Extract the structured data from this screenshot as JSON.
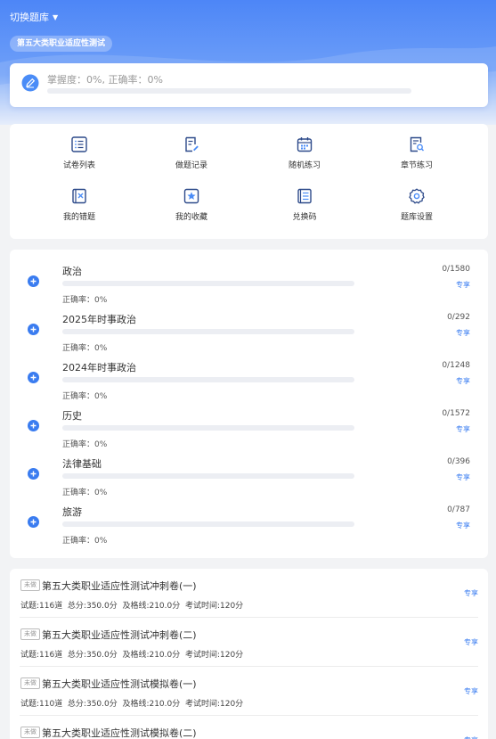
{
  "header": {
    "switch_label": "切换题库",
    "caret": "▼",
    "bank_name": "第五大类职业适应性测试"
  },
  "progress": {
    "text": "掌握度：0%, 正确率：0%",
    "mastery_fraction": 0
  },
  "menu": [
    {
      "label": "试卷列表",
      "icon": "list-icon"
    },
    {
      "label": "做题记录",
      "icon": "record-icon"
    },
    {
      "label": "随机练习",
      "icon": "calendar-icon"
    },
    {
      "label": "章节练习",
      "icon": "chapter-search-icon"
    },
    {
      "label": "我的错题",
      "icon": "wrong-book-icon"
    },
    {
      "label": "我的收藏",
      "icon": "star-icon"
    },
    {
      "label": "兑换码",
      "icon": "code-list-icon"
    },
    {
      "label": "题库设置",
      "icon": "gear-icon"
    }
  ],
  "subjects": [
    {
      "name": "政治",
      "count": "0/1580",
      "accuracy": "正确率：0%",
      "badge": "专享",
      "fraction": 0
    },
    {
      "name": "2025年时事政治",
      "count": "0/292",
      "accuracy": "正确率：0%",
      "badge": "专享",
      "fraction": 0
    },
    {
      "name": "2024年时事政治",
      "count": "0/1248",
      "accuracy": "正确率：0%",
      "badge": "专享",
      "fraction": 0
    },
    {
      "name": "历史",
      "count": "0/1572",
      "accuracy": "正确率：0%",
      "badge": "专享",
      "fraction": 0
    },
    {
      "name": "法律基础",
      "count": "0/396",
      "accuracy": "正确率：0%",
      "badge": "专享",
      "fraction": 0
    },
    {
      "name": "旅游",
      "count": "0/787",
      "accuracy": "正确率：0%",
      "badge": "专享",
      "fraction": 0
    }
  ],
  "papers": [
    {
      "tag": "未做",
      "title": "第五大类职业适应性测试冲刺卷(一)",
      "meta": "试题:116道  总分:350.0分  及格线:210.0分  考试时间:120分",
      "share": "专享"
    },
    {
      "tag": "未做",
      "title": "第五大类职业适应性测试冲刺卷(二)",
      "meta": "试题:116道  总分:350.0分  及格线:210.0分  考试时间:120分",
      "share": "专享"
    },
    {
      "tag": "未做",
      "title": "第五大类职业适应性测试模拟卷(一)",
      "meta": "试题:110道  总分:350.0分  及格线:210.0分  考试时间:120分",
      "share": "专享"
    },
    {
      "tag": "未做",
      "title": "第五大类职业适应性测试模拟卷(二)",
      "meta": "",
      "share": "专享"
    }
  ],
  "colors": {
    "accent": "#3a7cf0",
    "hero": "#4d86f7"
  }
}
